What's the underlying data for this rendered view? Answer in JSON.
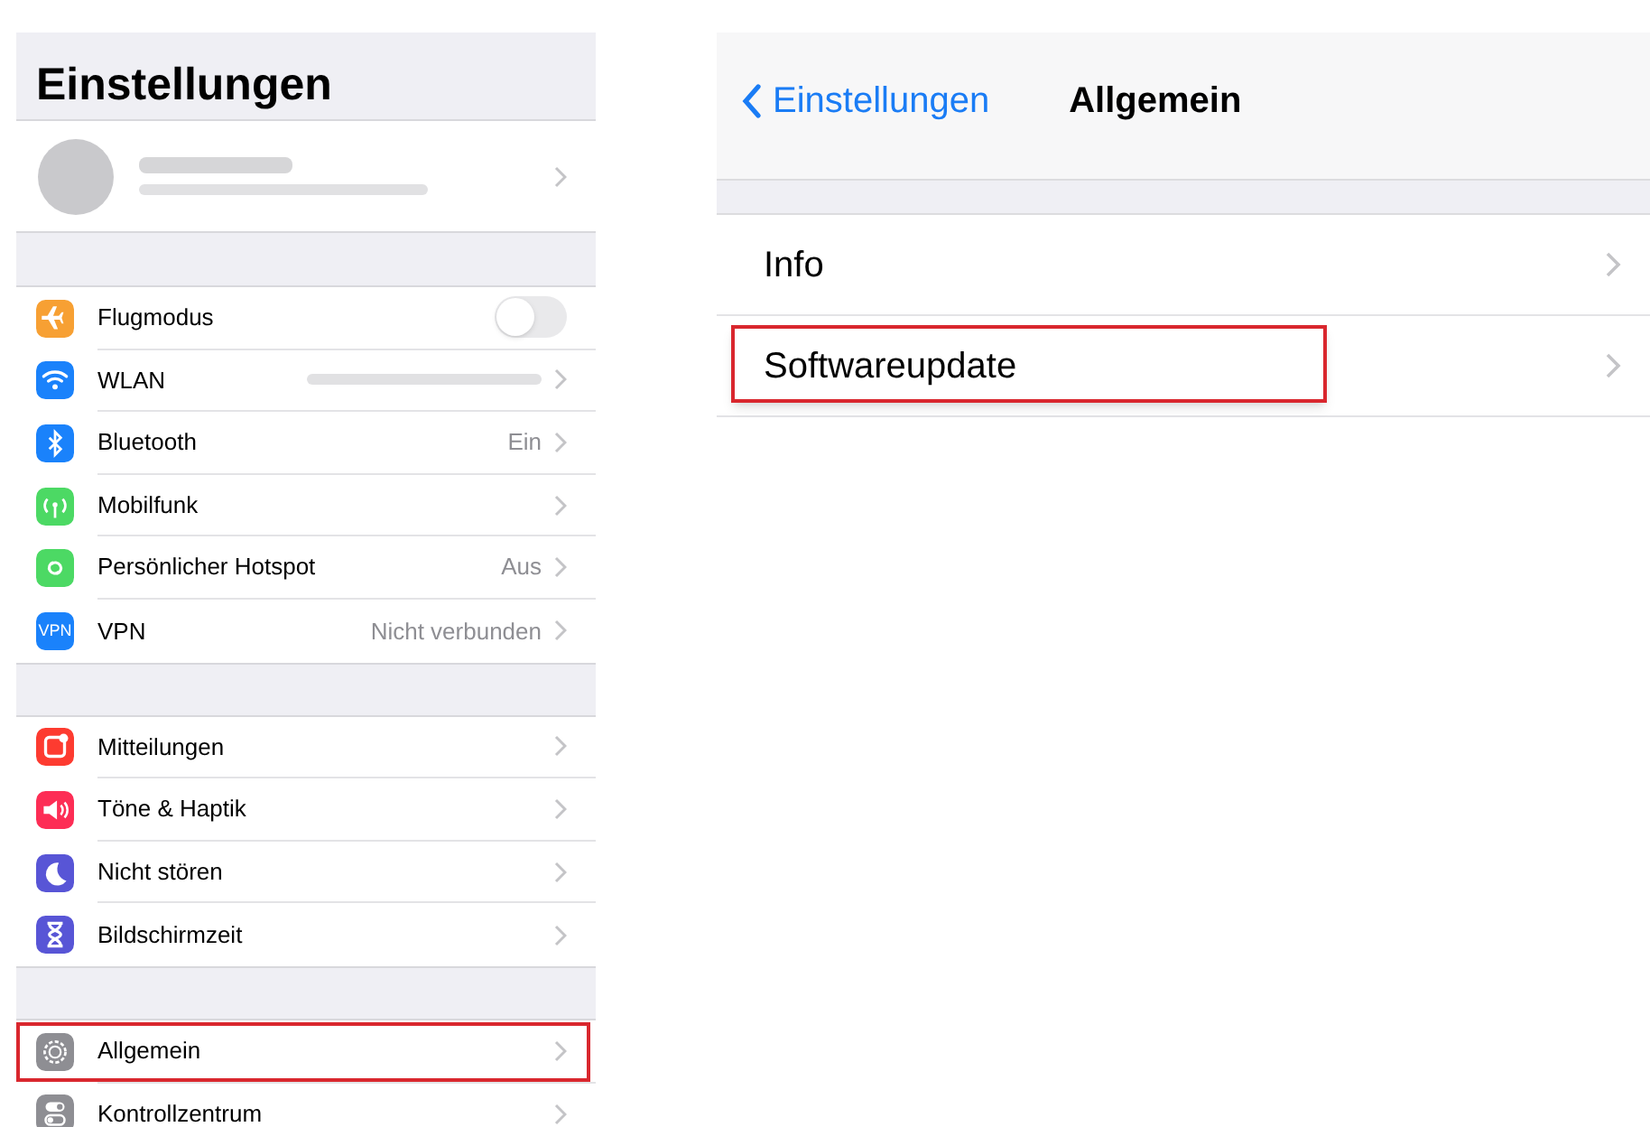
{
  "settings_panel": {
    "title": "Einstellungen",
    "groups": [
      [
        {
          "label": "Flugmodus",
          "kind": "toggle",
          "on": false,
          "highlighted": false
        },
        {
          "label": "WLAN",
          "kind": "blurred_value",
          "highlighted": false
        },
        {
          "label": "Bluetooth",
          "kind": "link",
          "value": "Ein",
          "highlighted": false
        },
        {
          "label": "Mobilfunk",
          "kind": "link",
          "highlighted": false
        },
        {
          "label": "Persönlicher Hotspot",
          "kind": "link",
          "value": "Aus",
          "highlighted": false
        },
        {
          "icon_text": "VPN",
          "label": "VPN",
          "kind": "link",
          "value": "Nicht verbunden",
          "highlighted": false
        }
      ],
      [
        {
          "label": "Mitteilungen",
          "kind": "link",
          "highlighted": false
        },
        {
          "label": "Töne & Haptik",
          "kind": "link",
          "highlighted": false
        },
        {
          "label": "Nicht stören",
          "kind": "link",
          "highlighted": false
        },
        {
          "label": "Bildschirmzeit",
          "kind": "link",
          "highlighted": false
        }
      ],
      [
        {
          "label": "Allgemein",
          "kind": "link",
          "highlighted": true
        },
        {
          "label": "Kontrollzentrum",
          "kind": "link",
          "highlighted": false
        }
      ]
    ]
  },
  "general_panel": {
    "back_label": "Einstellungen",
    "title": "Allgemein",
    "rows": [
      {
        "label": "Info",
        "highlighted": false
      },
      {
        "label": "Softwareupdate",
        "highlighted": true
      }
    ]
  }
}
